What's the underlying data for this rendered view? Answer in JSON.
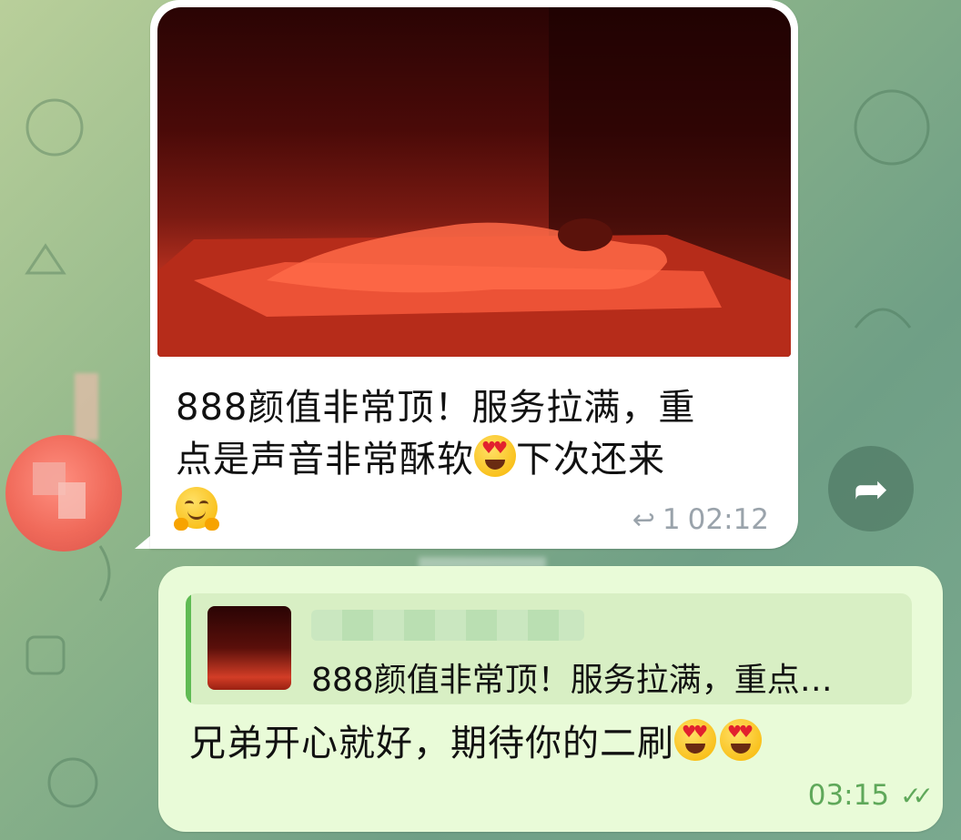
{
  "incoming_message": {
    "text_line1": "888颜值非常顶！服务拉满，重",
    "text_line2a": "点是声音非常酥软",
    "text_line2b": "下次还来",
    "reply_count": "1",
    "time": "02:12",
    "emojis": [
      "heart-eyes-emoji",
      "hugging-face-emoji"
    ]
  },
  "outgoing_message": {
    "quoted_text": "888颜值非常顶！服务拉满，重点…",
    "text": "兄弟开心就好，期待你的二刷",
    "time": "03:15",
    "status": "read",
    "emojis": [
      "heart-eyes-emoji",
      "heart-eyes-emoji"
    ]
  },
  "colors": {
    "incoming_bubble": "#ffffff",
    "outgoing_bubble": "#e9fbd8",
    "accent_green": "#5fbb53",
    "avatar": "#f06a5a"
  }
}
